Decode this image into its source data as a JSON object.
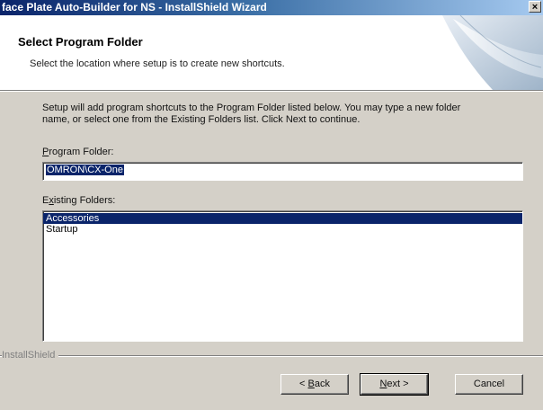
{
  "window": {
    "title": "face Plate Auto-Builder for NS - InstallShield Wizard",
    "close_glyph": "×"
  },
  "header": {
    "title": "Select Program Folder",
    "subtitle": "Select the location where setup is to create new shortcuts."
  },
  "instructions": {
    "line1": "Setup will add program shortcuts to the Program Folder listed below. You may type a new folder",
    "line2": "name, or select one from the Existing Folders list.  Click Next to continue."
  },
  "program_folder": {
    "label_hotkey": "P",
    "label_rest": "rogram Folder:",
    "value": "OMRON\\CX-One"
  },
  "existing_folders": {
    "label_first": "E",
    "label_hotkey": "x",
    "label_rest": "isting Folders:",
    "items": [
      "Accessories",
      "Startup"
    ],
    "selected_index": 0
  },
  "footer": {
    "brand": "InstallShield"
  },
  "buttons": {
    "back_prefix": "< ",
    "back_hotkey": "B",
    "back_rest": "ack",
    "next_hotkey": "N",
    "next_rest": "ext >",
    "cancel": "Cancel"
  }
}
